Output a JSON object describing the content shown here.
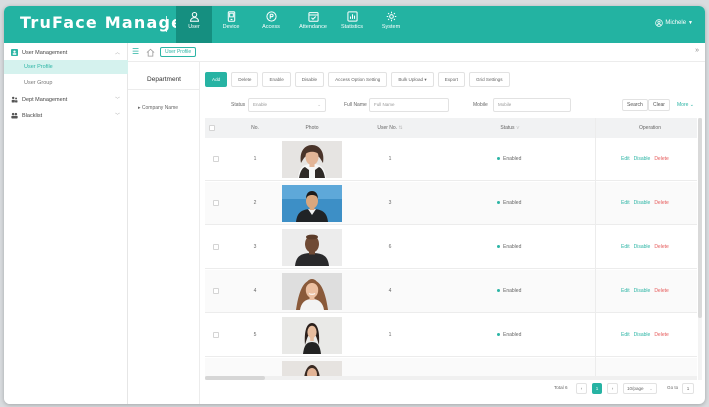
{
  "app": {
    "title": "TruFace Manager"
  },
  "nav": [
    {
      "label": "User",
      "icon": "user-icon"
    },
    {
      "label": "Device",
      "icon": "device-icon"
    },
    {
      "label": "Access",
      "icon": "access-icon"
    },
    {
      "label": "Attendance",
      "icon": "attendance-icon"
    },
    {
      "label": "Statistics",
      "icon": "statistics-icon"
    },
    {
      "label": "System",
      "icon": "system-icon"
    }
  ],
  "user_menu": {
    "name": "Michele"
  },
  "sidebar": {
    "group": "User Management",
    "sub_items": [
      "User Profile",
      "User Group"
    ],
    "items": [
      "Dept Management",
      "Blacklist"
    ]
  },
  "breadcrumb": {
    "current_tab": "User Profile"
  },
  "department": {
    "title": "Department",
    "root": "Company Name"
  },
  "toolbar": {
    "add": "Add",
    "delete": "Delete",
    "enable": "Enable",
    "disable": "Disable",
    "access_option": "Access Option Setting",
    "bulk_upload": "Bulk Upload",
    "export": "Export",
    "grid_settings": "Grid Settings"
  },
  "filters": {
    "status_label": "Status",
    "status_value": "Enable",
    "fullname_label": "Full Name",
    "fullname_placeholder": "Full Name",
    "mobile_label": "Mobile",
    "mobile_placeholder": "Mobile",
    "search": "Search",
    "clear": "Clear",
    "more": "More"
  },
  "table": {
    "headers": {
      "no": "No.",
      "photo": "Photo",
      "user_no": "User No.",
      "status": "Status",
      "operation": "Operation"
    },
    "rows": [
      {
        "no": "1",
        "user_no": "1",
        "status": "Enabled"
      },
      {
        "no": "2",
        "user_no": "3",
        "status": "Enabled"
      },
      {
        "no": "3",
        "user_no": "6",
        "status": "Enabled"
      },
      {
        "no": "4",
        "user_no": "4",
        "status": "Enabled"
      },
      {
        "no": "5",
        "user_no": "1",
        "status": "Enabled"
      },
      {
        "no": "",
        "user_no": "",
        "status": ""
      }
    ],
    "ops": {
      "edit": "Edit",
      "disable": "Disable",
      "delete": "Delete"
    }
  },
  "pagination": {
    "total": "Total 6",
    "current_page": "1",
    "page_size": "10/page",
    "goto_label": "Go to",
    "goto_value": "1"
  },
  "colors": {
    "accent": "#27b3a3",
    "danger": "#e65a5a"
  }
}
